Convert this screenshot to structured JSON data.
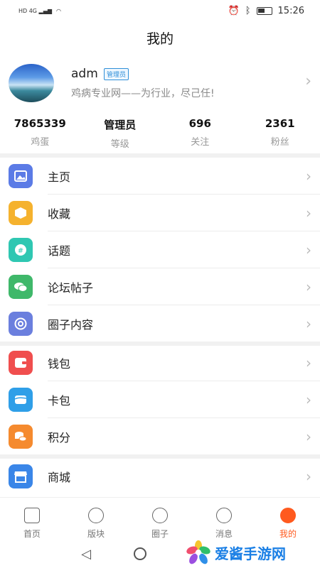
{
  "status": {
    "time": "15:26"
  },
  "header": {
    "title": "我的"
  },
  "profile": {
    "name": "adm",
    "badge": "管理员",
    "motto": "鸡病专业网——为行业，尽己任!"
  },
  "stats": [
    {
      "value": "7865339",
      "label": "鸡蛋"
    },
    {
      "value": "管理员",
      "label": "等级"
    },
    {
      "value": "696",
      "label": "关注"
    },
    {
      "value": "2361",
      "label": "粉丝"
    }
  ],
  "menu": {
    "group1": [
      {
        "label": "主页",
        "icon": "image-icon",
        "color": "#5b7be6"
      },
      {
        "label": "收藏",
        "icon": "box-icon",
        "color": "#f5b22e"
      },
      {
        "label": "话题",
        "icon": "hashtag-icon",
        "color": "#2fc7b2"
      },
      {
        "label": "论坛帖子",
        "icon": "chat-icon",
        "color": "#3fb86a"
      },
      {
        "label": "圈子内容",
        "icon": "circle-icon",
        "color": "#6b7fde"
      }
    ],
    "group2": [
      {
        "label": "钱包",
        "icon": "wallet-icon",
        "color": "#f04e4e"
      },
      {
        "label": "卡包",
        "icon": "card-icon",
        "color": "#2f9fe8"
      },
      {
        "label": "积分",
        "icon": "coins-icon",
        "color": "#f58a2e"
      }
    ],
    "group3": [
      {
        "label": "商城",
        "icon": "store-icon",
        "color": "#3a86e8"
      }
    ]
  },
  "tabs": [
    {
      "label": "首页",
      "icon": "home-icon"
    },
    {
      "label": "版块",
      "icon": "hexagon-icon"
    },
    {
      "label": "圈子",
      "icon": "circle-tab-icon"
    },
    {
      "label": "消息",
      "icon": "message-icon"
    },
    {
      "label": "我的",
      "icon": "profile-tab-icon",
      "active": true
    }
  ],
  "watermark": {
    "text": "爱酱手游网"
  },
  "colors": {
    "accent": "#ff5a1f",
    "badge": "#2f8fd8"
  }
}
